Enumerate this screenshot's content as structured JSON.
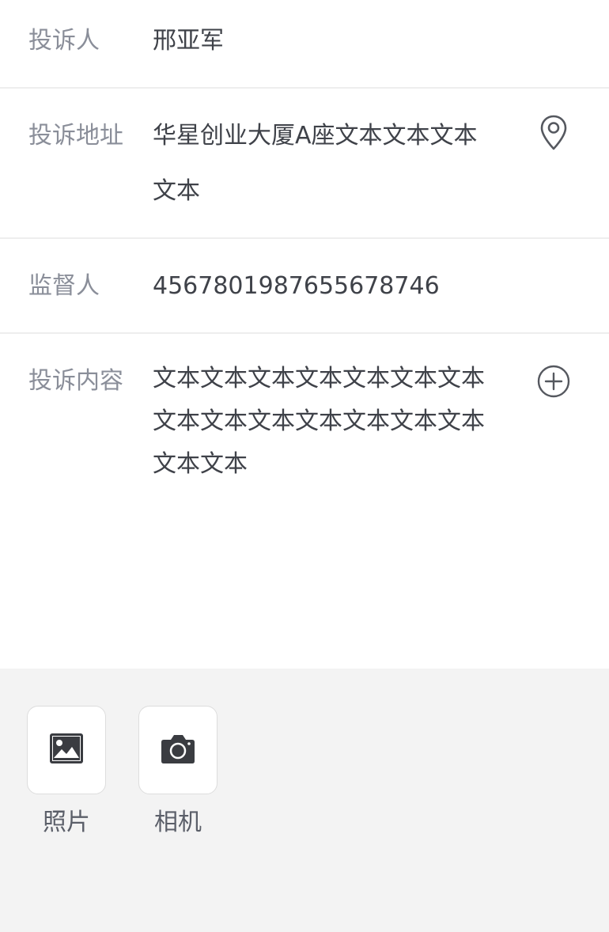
{
  "form": {
    "complainant": {
      "label": "投诉人",
      "value": "邢亚军"
    },
    "address": {
      "label": "投诉地址",
      "value": "华星创业大厦A座文本文本文本文本",
      "icon": "location-pin-icon"
    },
    "supervisor": {
      "label": "监督人",
      "value": "4567801987655678746"
    },
    "content": {
      "label": "投诉内容",
      "value": "文本文本文本文本文本文本文本文本文本文本文本文本文本文本文本文本",
      "icon": "plus-circle-icon"
    }
  },
  "attachments": {
    "photo": {
      "label": "照片",
      "icon": "image-icon"
    },
    "camera": {
      "label": "相机",
      "icon": "camera-icon"
    }
  },
  "colors": {
    "label": "#8a8e99",
    "value": "#3f4249",
    "divider": "#eeeeee",
    "panel_bg": "#f3f3f3",
    "icon": "#55585f"
  }
}
